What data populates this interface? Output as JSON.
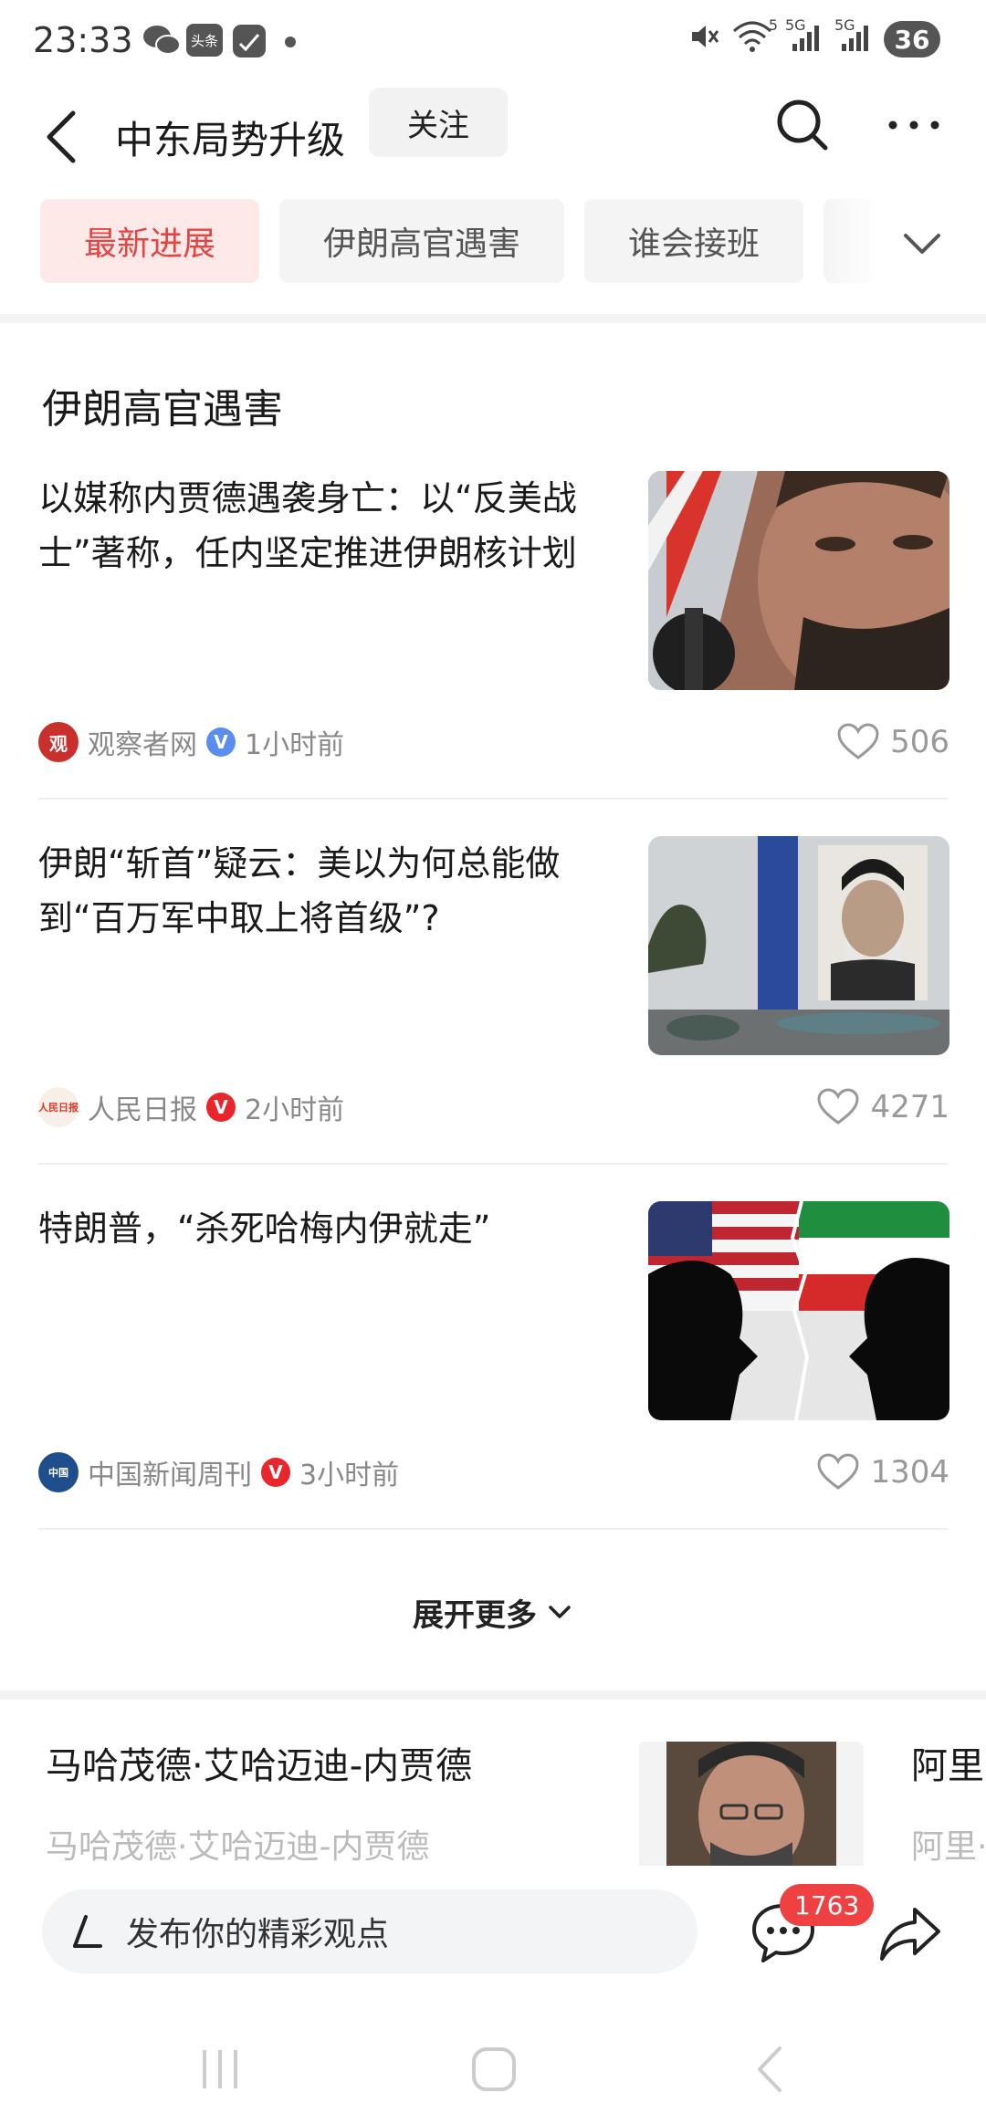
{
  "status_bar": {
    "time": "23:33",
    "app_icons": [
      "wechat-icon",
      "toutiao-icon",
      "sign-icon"
    ],
    "toutiao_label": "头条",
    "signal_labels": [
      "5",
      "5G",
      "5G"
    ],
    "battery": "36"
  },
  "header": {
    "title": "中东局势升级",
    "follow_label": "关注"
  },
  "tabs": [
    {
      "label": "最新进展",
      "active": true
    },
    {
      "label": "伊朗高官遇害",
      "active": false
    },
    {
      "label": "谁会接班",
      "active": false
    }
  ],
  "section": {
    "title": "伊朗高官遇害"
  },
  "articles": [
    {
      "title": "以媒称内贾德遇袭身亡：以“反美战士”著称，任内坚定推进伊朗核计划",
      "source": "观察者网",
      "source_logo_text": "观",
      "source_color": "#c9302c",
      "verified_color": "#5b8def",
      "time": "1小时前",
      "likes": "506"
    },
    {
      "title": "伊朗“斩首”疑云：美以为何总能做到“百万军中取上将首级”?",
      "source": "人民日报",
      "source_logo_text": "人民日报",
      "source_color": "#d93a2b",
      "verified_color": "#e8262b",
      "time": "2小时前",
      "likes": "4271"
    },
    {
      "title": "特朗普，“杀死哈梅内伊就走”",
      "source": "中国新闻周刊",
      "source_logo_text": "中国",
      "source_color": "#1f4e8c",
      "verified_color": "#e8262b",
      "time": "3小时前",
      "likes": "1304"
    }
  ],
  "expand_more_label": "展开更多",
  "related_people": [
    {
      "name": "马哈茂德·艾哈迈迪-内贾德",
      "subtitle": "马哈茂德·艾哈迈迪-内贾德"
    },
    {
      "name": "阿里",
      "subtitle": "阿里·"
    }
  ],
  "bottom_bar": {
    "placeholder": "发布你的精彩观点",
    "comment_count": "1763"
  },
  "colors": {
    "accent": "#e54443",
    "active_tab_bg": "#fde9e7",
    "badge": "#f04142"
  }
}
